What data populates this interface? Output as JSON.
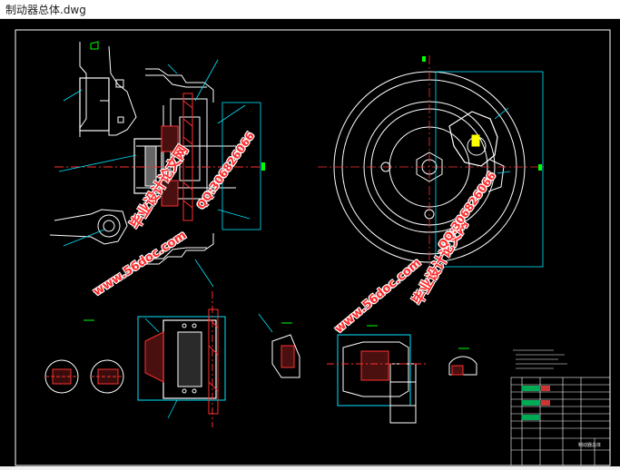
{
  "window": {
    "title": "制动器总体.dwg"
  },
  "watermarks": {
    "brand": "毕业设计论文网",
    "url": "www.56doc.com",
    "qq": "QQ:306826066"
  },
  "title_block": {
    "drawing_name": "制动器总体"
  },
  "colors": {
    "background": "#000000",
    "geometry": "#ffffff",
    "centerline": "#ff3030",
    "leader": "#00e5ff",
    "marker": "#00ff00",
    "watermark": "#ff2a2a"
  }
}
